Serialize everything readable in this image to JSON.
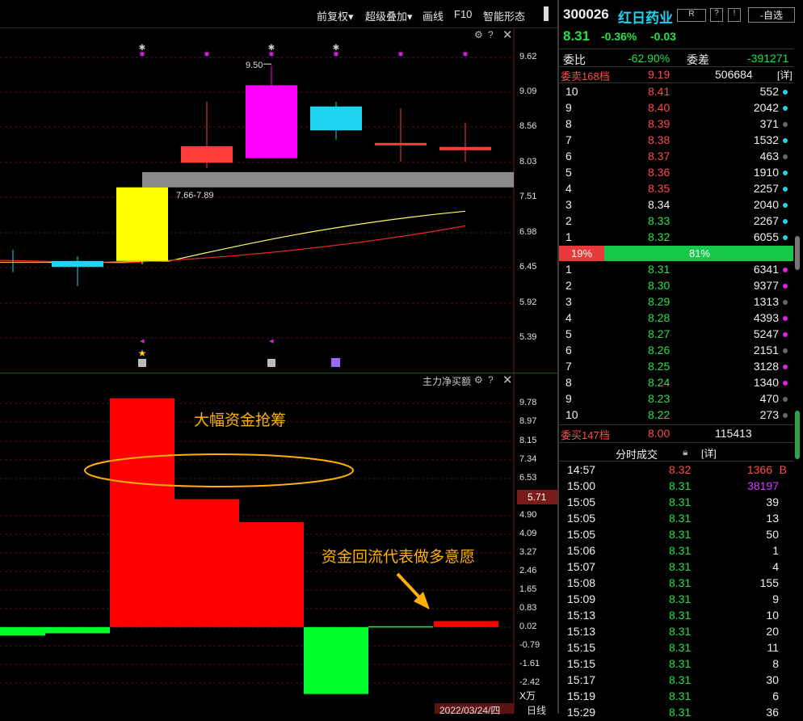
{
  "toolbar": {
    "fuquan": "前复权▾",
    "chaoji": "超级叠加▾",
    "huaxian": "画线",
    "f10": "F10",
    "zhineng": "智能形态"
  },
  "stock": {
    "code": "300026",
    "name": "红日药业",
    "r_badge": "R",
    "zixuan": "-自选",
    "price": "8.31",
    "change_pct": "-0.36%",
    "change": "-0.03"
  },
  "weibi": {
    "label": "委比",
    "value": "-62.90%",
    "label2": "委差",
    "value2": "-391271"
  },
  "sell_header": {
    "label": "委卖168档",
    "price": "9.19",
    "vol": "506684",
    "detail": "[详]"
  },
  "asks": [
    {
      "lv": "10",
      "price": "8.41",
      "vol": "552",
      "dot": "#1ed4f0"
    },
    {
      "lv": "9",
      "price": "8.40",
      "vol": "2042",
      "dot": "#1ed4f0"
    },
    {
      "lv": "8",
      "price": "8.39",
      "vol": "371",
      "dot": "#666666"
    },
    {
      "lv": "7",
      "price": "8.38",
      "vol": "1532",
      "dot": "#1ed4f0"
    },
    {
      "lv": "6",
      "price": "8.37",
      "vol": "463",
      "dot": "#666666"
    },
    {
      "lv": "5",
      "price": "8.36",
      "vol": "1910",
      "dot": "#1ed4f0"
    },
    {
      "lv": "4",
      "price": "8.35",
      "vol": "2257",
      "dot": "#1ed4f0"
    },
    {
      "lv": "3",
      "price": "8.34",
      "vol": "2040",
      "dot": "#1ed4f0"
    },
    {
      "lv": "2",
      "price": "8.33",
      "vol": "2267",
      "dot": "#1ed4f0"
    },
    {
      "lv": "1",
      "price": "8.32",
      "vol": "6055",
      "dot": "#1ed4f0"
    }
  ],
  "ratio": {
    "left": "19%",
    "right": "81%"
  },
  "bids": [
    {
      "lv": "1",
      "price": "8.31",
      "vol": "6341",
      "dot": "#e020e0"
    },
    {
      "lv": "2",
      "price": "8.30",
      "vol": "9377",
      "dot": "#e020e0"
    },
    {
      "lv": "3",
      "price": "8.29",
      "vol": "1313",
      "dot": "#666666"
    },
    {
      "lv": "4",
      "price": "8.28",
      "vol": "4393",
      "dot": "#e020e0"
    },
    {
      "lv": "5",
      "price": "8.27",
      "vol": "5247",
      "dot": "#e020e0"
    },
    {
      "lv": "6",
      "price": "8.26",
      "vol": "2151",
      "dot": "#666666"
    },
    {
      "lv": "7",
      "price": "8.25",
      "vol": "3128",
      "dot": "#e020e0"
    },
    {
      "lv": "8",
      "price": "8.24",
      "vol": "1340",
      "dot": "#e020e0"
    },
    {
      "lv": "9",
      "price": "8.23",
      "vol": "470",
      "dot": "#666666"
    },
    {
      "lv": "10",
      "price": "8.22",
      "vol": "273",
      "dot": "#666666"
    }
  ],
  "buy_header": {
    "label": "委买147档",
    "price": "8.00",
    "vol": "115413"
  },
  "trades_header": {
    "label": "分时成交",
    "detail": "[详]"
  },
  "trades": [
    {
      "t": "14:57",
      "p": "8.32",
      "v": "1366",
      "flag": "B",
      "vc": "#ff4a4a"
    },
    {
      "t": "15:00",
      "p": "8.31",
      "v": "38197",
      "flag": "",
      "vc": "#d040ff"
    },
    {
      "t": "15:05",
      "p": "8.31",
      "v": "39",
      "flag": "",
      "vc": "#f0f0f0"
    },
    {
      "t": "15:05",
      "p": "8.31",
      "v": "13",
      "flag": "",
      "vc": "#f0f0f0"
    },
    {
      "t": "15:05",
      "p": "8.31",
      "v": "50",
      "flag": "",
      "vc": "#f0f0f0"
    },
    {
      "t": "15:06",
      "p": "8.31",
      "v": "1",
      "flag": "",
      "vc": "#f0f0f0"
    },
    {
      "t": "15:07",
      "p": "8.31",
      "v": "4",
      "flag": "",
      "vc": "#f0f0f0"
    },
    {
      "t": "15:08",
      "p": "8.31",
      "v": "155",
      "flag": "",
      "vc": "#f0f0f0"
    },
    {
      "t": "15:09",
      "p": "8.31",
      "v": "9",
      "flag": "",
      "vc": "#f0f0f0"
    },
    {
      "t": "15:13",
      "p": "8.31",
      "v": "10",
      "flag": "",
      "vc": "#f0f0f0"
    },
    {
      "t": "15:13",
      "p": "8.31",
      "v": "20",
      "flag": "",
      "vc": "#f0f0f0"
    },
    {
      "t": "15:15",
      "p": "8.31",
      "v": "11",
      "flag": "",
      "vc": "#f0f0f0"
    },
    {
      "t": "15:15",
      "p": "8.31",
      "v": "8",
      "flag": "",
      "vc": "#f0f0f0"
    },
    {
      "t": "15:17",
      "p": "8.31",
      "v": "30",
      "flag": "",
      "vc": "#f0f0f0"
    },
    {
      "t": "15:19",
      "p": "8.31",
      "v": "6",
      "flag": "",
      "vc": "#f0f0f0"
    },
    {
      "t": "15:29",
      "p": "8.31",
      "v": "36",
      "flag": "",
      "vc": "#f0f0f0"
    }
  ],
  "kline": {
    "price_axis": [
      "9.62",
      "9.09",
      "8.56",
      "8.03",
      "7.51",
      "6.98",
      "6.45",
      "5.92",
      "5.39"
    ],
    "peak_label": "9.50",
    "gap_label": "7.66-7.89",
    "candles": [
      {
        "o": 6.46,
        "c": 6.55,
        "h": 6.62,
        "l": 6.17,
        "color": "#1ed4f0"
      },
      {
        "o": 6.55,
        "c": 7.66,
        "h": 7.66,
        "l": 6.5,
        "color": "#ffff00"
      },
      {
        "o": 8.03,
        "c": 8.28,
        "h": 8.95,
        "l": 7.95,
        "color": "#ff3b3b"
      },
      {
        "o": 8.1,
        "c": 9.2,
        "h": 9.5,
        "l": 8.1,
        "color": "#ff00ff"
      },
      {
        "o": 8.88,
        "c": 8.52,
        "h": 8.95,
        "l": 8.38,
        "color": "#1ed4f0"
      },
      {
        "o": 8.33,
        "c": 8.3,
        "h": 8.85,
        "l": 8.05,
        "color": "#ff3b3b"
      },
      {
        "o": 8.27,
        "c": 8.22,
        "h": 8.64,
        "l": 8.05,
        "color": "#ff3b3b"
      }
    ]
  },
  "flow": {
    "indicator_name": "主力净买额",
    "axis": [
      "9.78",
      "8.97",
      "8.15",
      "7.34",
      "6.53",
      "4.90",
      "4.09",
      "3.27",
      "2.46",
      "1.65",
      "0.83",
      "0.02",
      "-0.79",
      "-1.61",
      "-2.42"
    ],
    "current": "5.71",
    "unit": "X万",
    "date_label": "2022/03/24/四",
    "period": "日线",
    "annotation1": "大幅资金抢筹",
    "annotation2": "资金回流代表做多意愿"
  },
  "chart_data": [
    {
      "type": "bar",
      "title": "主力净买额",
      "ylabel": "X万",
      "ylim": [
        -2.42,
        9.78
      ],
      "values": [
        -0.35,
        -0.25,
        10.0,
        5.6,
        4.6,
        -2.9,
        0.02,
        0.28
      ]
    }
  ]
}
